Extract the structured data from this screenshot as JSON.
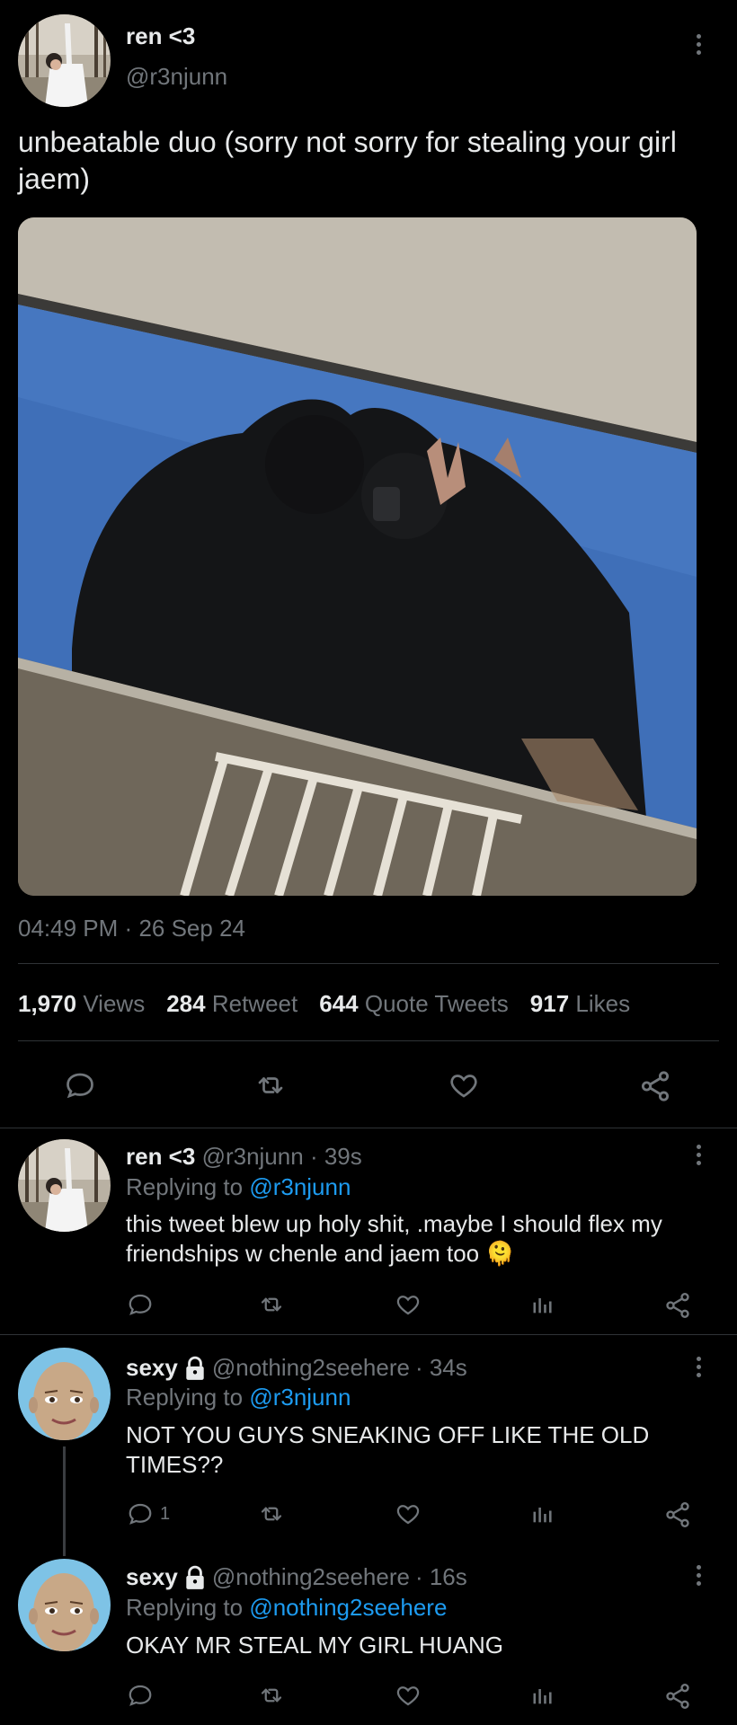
{
  "main_tweet": {
    "display_name": "ren <3",
    "handle": "@r3njunn",
    "text": "unbeatable duo (sorry not sorry for stealing your girl jaem)",
    "time": "04:49 PM",
    "sep": "·",
    "date": "26 Sep 24",
    "stats": [
      {
        "value": "1,970",
        "label": "Views"
      },
      {
        "value": "284",
        "label": "Retweet"
      },
      {
        "value": "644",
        "label": "Quote Tweets"
      },
      {
        "value": "917",
        "label": "Likes"
      }
    ],
    "actions": [
      "reply-icon",
      "retweet-icon",
      "like-icon",
      "share-icon"
    ]
  },
  "replies": [
    {
      "display_name": "ren <3",
      "handle": "@r3njunn",
      "time": "· 39s",
      "replying_label": "Replying to",
      "replying_to": "@r3njunn",
      "text": "this tweet blew up holy shit, .maybe I should flex my friendships w chenle and jaem too",
      "emoji": "🫠",
      "reply_count": ""
    },
    {
      "display_name": "sexy",
      "handle": "@nothing2seehere",
      "time": "· 34s",
      "replying_label": "Replying to",
      "replying_to": "@r3njunn",
      "text": "NOT YOU GUYS SNEAKING OFF LIKE THE OLD TIMES??",
      "reply_count": "1"
    },
    {
      "display_name": "sexy",
      "handle": "@nothing2seehere",
      "time": "· 16s",
      "replying_label": "Replying to",
      "replying_to": "@nothing2seehere",
      "text": "OKAY MR STEAL MY GIRL HUANG",
      "reply_count": ""
    }
  ],
  "colors": {
    "background": "#000000",
    "text": "#e7e9ea",
    "muted": "#71767b",
    "link": "#1d9bf0",
    "divider": "#2f3336"
  }
}
